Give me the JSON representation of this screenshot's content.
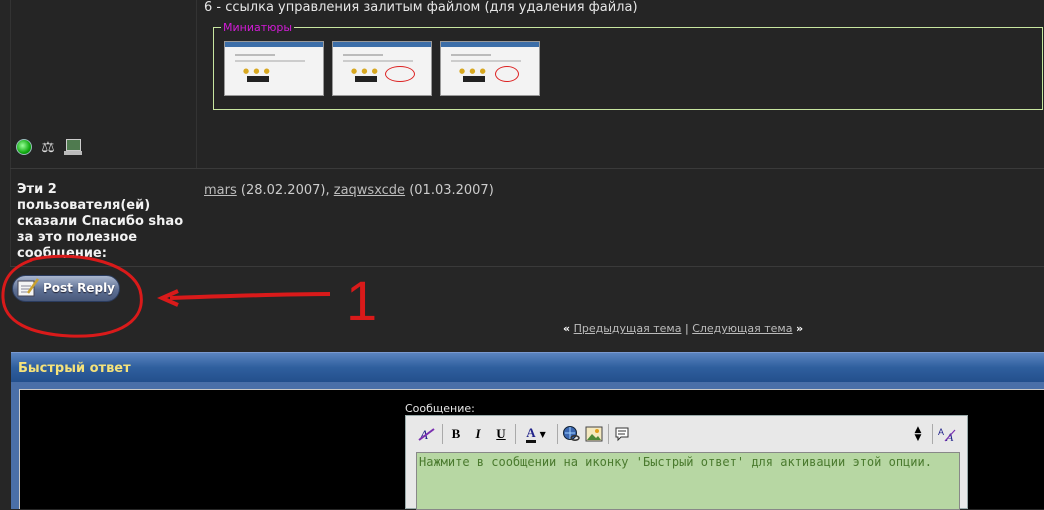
{
  "post": {
    "note_text": "6 - ссылка управления залитым файлом (для удаления файла)",
    "thumbnails_legend": "Миниатюры",
    "thumbnails_count": 3
  },
  "status_icons": [
    "online-status-icon",
    "reputation-scales-icon",
    "computer-icon"
  ],
  "thanks": {
    "label": "Эти 2 пользователя(ей) сказали Спасибо shao за это полезное сообщение:",
    "users": [
      {
        "name": "mars",
        "date": "(28.02.2007)"
      },
      {
        "name": "zaqwsxcde",
        "date": "(01.03.2007)"
      }
    ],
    "separator": ","
  },
  "post_reply_button": {
    "label": "Post Reply",
    "icon": "post-reply-icon"
  },
  "annotation": {
    "number": "1",
    "color": "#d91a1a"
  },
  "thread_nav": {
    "prev_arrow": "«",
    "prev_label": "Предыдущая тема",
    "divider": "|",
    "next_label": "Следующая тема",
    "next_arrow": "»"
  },
  "quick_reply": {
    "title": "Быстрый ответ",
    "message_label": "Сообщение:",
    "message_text": "Нажмите в сообщении на иконку 'Быстрый ответ' для активации этой опции."
  },
  "editor_toolbar": {
    "bold": "B",
    "italic": "I",
    "underline": "U",
    "font_color": "A",
    "icons": [
      "remove-format-icon",
      "bold-icon",
      "italic-icon",
      "underline-icon",
      "font-color-icon",
      "insert-link-icon",
      "insert-image-icon",
      "quote-icon",
      "resize-icon",
      "switch-mode-icon"
    ]
  },
  "colors": {
    "background": "#262626",
    "header_blue": "#2f5f9e",
    "header_title": "#f5e27a",
    "legend_magenta": "#d21bd6",
    "editor_green": "#b7d7a3"
  }
}
